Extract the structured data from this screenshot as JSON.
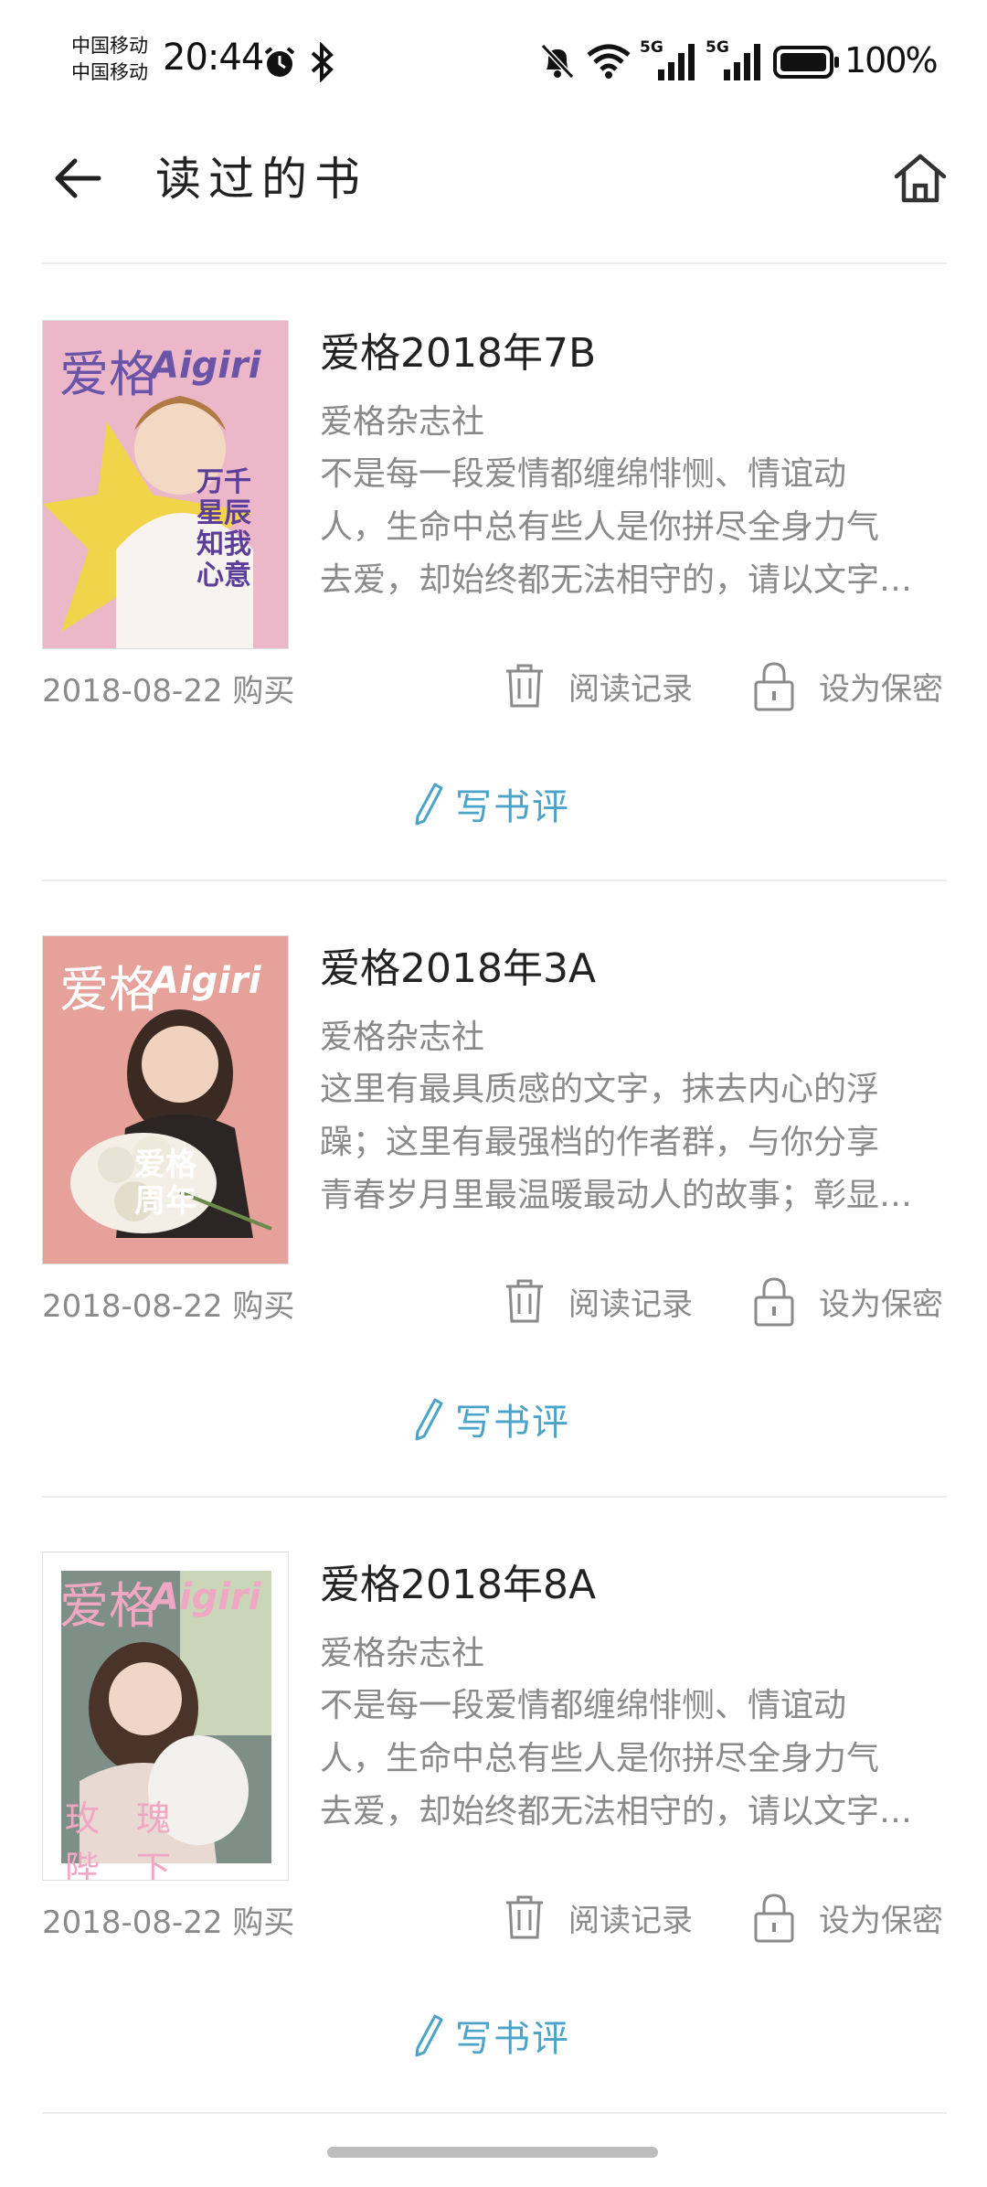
{
  "status_bar": {
    "carrier_1": "中国移动",
    "carrier_2": "中国移动",
    "time": "20:44",
    "signal_1_label": "5G",
    "signal_2_label": "5G",
    "battery": "100%"
  },
  "header": {
    "title": "读过的书"
  },
  "books": [
    {
      "title": "爱格2018年7B",
      "author": "爱格杂志社",
      "desc_lines": [
        "不是每一段爱情都缠绵悱恻、情谊动",
        "人，生命中总有些人是你拼尽全身力气",
        "去爱，却始终都无法相守的，请以文字…"
      ],
      "date": "2018-08-22 购买",
      "record_label": "阅读记录",
      "secret_label": "设为保密",
      "review_label": "写书评",
      "cover": {
        "logo": "爱格",
        "logo_en": "Aigiri",
        "tagline": "万千星辰 知我心意",
        "bg": "#ecb7c9",
        "accent": "#f2d44a"
      }
    },
    {
      "title": "爱格2018年3A",
      "author": "爱格杂志社",
      "desc_lines": [
        "这里有最具质感的文字，抹去内心的浮",
        "躁；这里有最强档的作者群，与你分享",
        "青春岁月里最温暖最动人的故事；彰显…"
      ],
      "date": "2018-08-22 购买",
      "record_label": "阅读记录",
      "secret_label": "设为保密",
      "review_label": "写书评",
      "cover": {
        "logo": "爱格",
        "logo_en": "Aigiri",
        "tagline": "爱格 周年",
        "bg": "#e6a29a",
        "accent": "#f4efe6"
      }
    },
    {
      "title": "爱格2018年8A",
      "author": "爱格杂志社",
      "desc_lines": [
        "不是每一段爱情都缠绵悱恻、情谊动",
        "人，生命中总有些人是你拼尽全身力气",
        "去爱，却始终都无法相守的，请以文字…"
      ],
      "date": "2018-08-22 购买",
      "record_label": "阅读记录",
      "secret_label": "设为保密",
      "review_label": "写书评",
      "cover": {
        "logo": "爱格",
        "logo_en": "Aigiri",
        "tagline": "玫瑰 陛下",
        "bg": "#7d8f86",
        "accent": "#f0d6e0"
      }
    }
  ],
  "colors": {
    "accent": "#4aa3c8",
    "secondary_text": "#8a8a8a",
    "divider": "#ececec"
  }
}
